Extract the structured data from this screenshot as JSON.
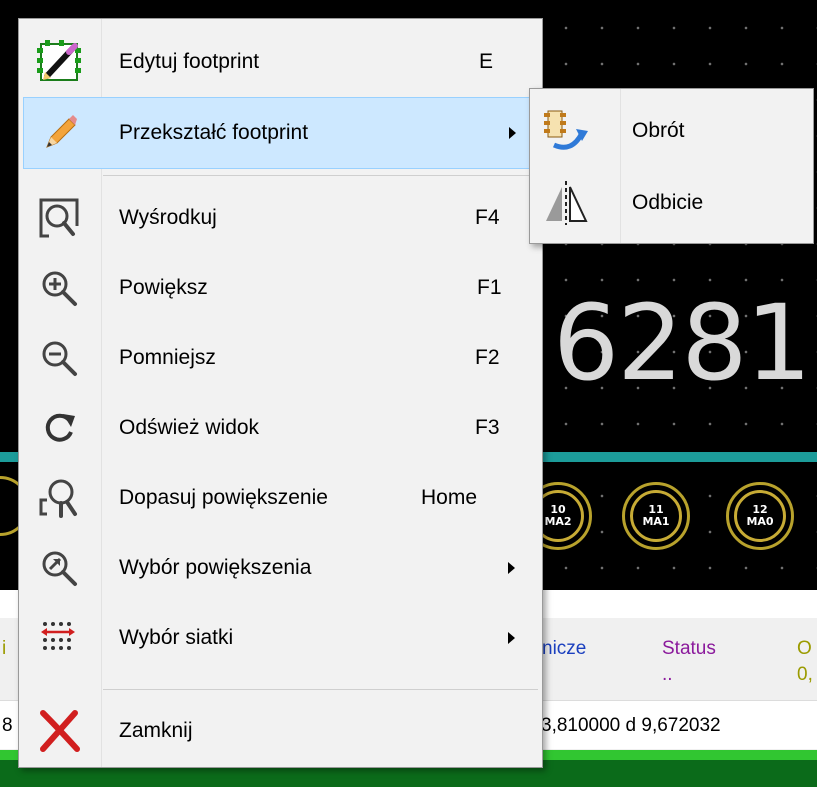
{
  "canvas": {
    "big_number": "6281",
    "pads": [
      {
        "number": "10",
        "name": "MA2"
      },
      {
        "number": "11",
        "name": "MA1"
      },
      {
        "number": "12",
        "name": "MA0"
      }
    ]
  },
  "status_bar": {
    "col_left_fragment": "i",
    "col_clearance_header": "nicze",
    "status_header": "Status",
    "status_value": "..",
    "right_header_fragment": "O",
    "right_value_fragment": "0,",
    "coords_left_fragment": "8",
    "coords_text": "3,810000  d 9,672032"
  },
  "context_menu": {
    "items": [
      {
        "label": "Edytuj footprint",
        "shortcut": "E",
        "icon": "edit-footprint-icon"
      },
      {
        "label": "Przekształć footprint",
        "shortcut": "",
        "icon": "pencil-icon",
        "submenu": true,
        "highlighted": true
      },
      {
        "label": "Wyśrodkuj",
        "shortcut": "F4",
        "icon": "zoom-center-icon"
      },
      {
        "label": "Powiększ",
        "shortcut": "F1",
        "icon": "zoom-in-icon"
      },
      {
        "label": "Pomniejsz",
        "shortcut": "F2",
        "icon": "zoom-out-icon"
      },
      {
        "label": "Odśwież widok",
        "shortcut": "F3",
        "icon": "refresh-icon"
      },
      {
        "label": "Dopasuj powiększenie",
        "shortcut": "Home",
        "icon": "zoom-fit-icon"
      },
      {
        "label": "Wybór powiększenia",
        "shortcut": "",
        "icon": "zoom-select-icon",
        "submenu": true
      },
      {
        "label": "Wybór siatki",
        "shortcut": "",
        "icon": "grid-select-icon",
        "submenu": true
      },
      {
        "label": "Zamknij",
        "shortcut": "",
        "icon": "close-icon"
      }
    ]
  },
  "submenu": {
    "items": [
      {
        "label": "Obrót",
        "icon": "rotate-icon"
      },
      {
        "label": "Odbicie",
        "icon": "mirror-icon"
      }
    ]
  },
  "colors": {
    "menu_bg": "#f2f2f2",
    "highlight_bg": "#cde8ff",
    "highlight_border": "#99d1ff",
    "pcb_teal": "#1c9c9a",
    "pad_gold": "#c7ab35",
    "status_purple": "#8b1a9c",
    "status_olive": "#9b9b00",
    "close_red": "#d11f1f"
  }
}
